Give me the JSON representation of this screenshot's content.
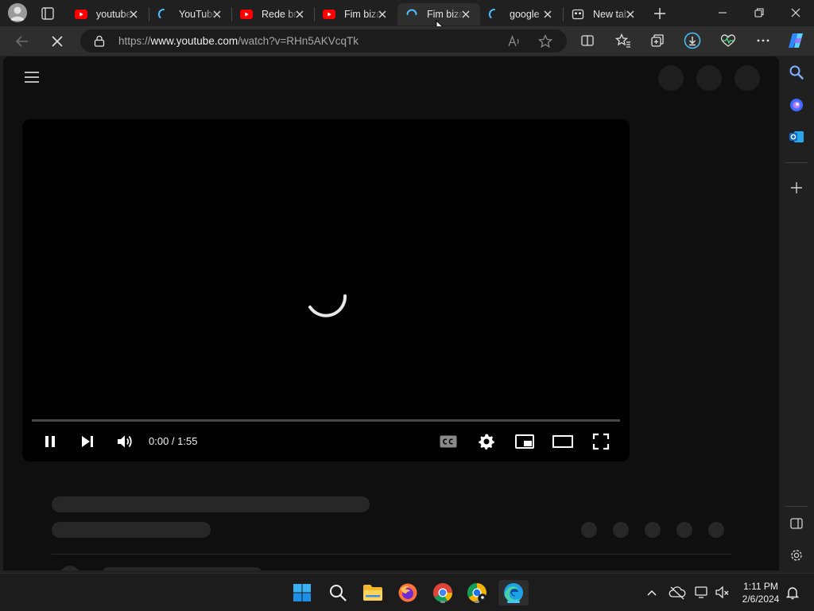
{
  "browser": {
    "tabs": [
      {
        "label": "youtube",
        "favicon": "youtube-icon",
        "active": false
      },
      {
        "label": "YouTube",
        "favicon": "loading-icon",
        "active": false
      },
      {
        "label": "Rede bras",
        "favicon": "youtube-icon",
        "active": false
      },
      {
        "label": "Fim bizarr",
        "favicon": "youtube-icon",
        "active": false
      },
      {
        "label": "Fim bizarr",
        "favicon": "loading-icon",
        "active": true
      },
      {
        "label": "google",
        "favicon": "loading-icon",
        "active": false
      },
      {
        "label": "New tab",
        "favicon": "new-tab-icon",
        "active": false
      }
    ],
    "address": {
      "scheme": "https://",
      "host": "www.youtube.com",
      "path": "/watch?v=RHn5AKVcqTk"
    }
  },
  "player": {
    "time": "0:00 / 1:55",
    "progress": 0
  },
  "taskbar": {
    "time": "1:11 PM",
    "date": "2/6/2024"
  },
  "colors": {
    "youtube_red": "#ff0000",
    "edge_accent": "#4cc2ff",
    "page_bg": "#0f0f0f",
    "chrome_bg": "#202020"
  }
}
